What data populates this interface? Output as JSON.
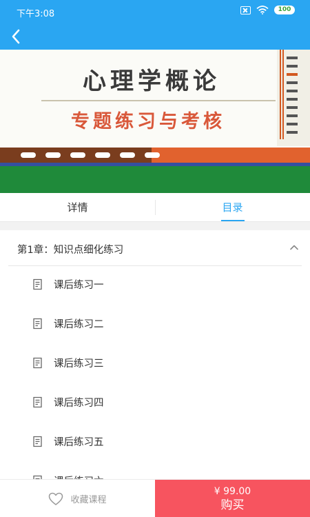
{
  "status_bar": {
    "time": "下午3:08",
    "battery": "100",
    "icons": [
      "no-sim-icon",
      "wifi-icon",
      "battery-icon"
    ]
  },
  "nav": {
    "back_icon": "chevron-left-icon"
  },
  "cover": {
    "title": "心理学概论",
    "subtitle": "专题练习与考核"
  },
  "tabs": [
    {
      "label": "详情",
      "active": false
    },
    {
      "label": "目录",
      "active": true
    }
  ],
  "chapter": {
    "title": "第1章：知识点细化练习",
    "expanded": true,
    "lessons": [
      {
        "label": "课后练习一"
      },
      {
        "label": "课后练习二"
      },
      {
        "label": "课后练习三"
      },
      {
        "label": "课后练习四"
      },
      {
        "label": "课后练习五"
      },
      {
        "label": "课后练习六"
      }
    ]
  },
  "footer": {
    "favorite_label": "收藏课程",
    "price": "¥ 99.00",
    "buy_label": "购买"
  },
  "colors": {
    "primary": "#2aa6f2",
    "buy_button": "#f7545f",
    "cover_title": "#3a3a3a",
    "cover_subtitle": "#d9583a"
  }
}
